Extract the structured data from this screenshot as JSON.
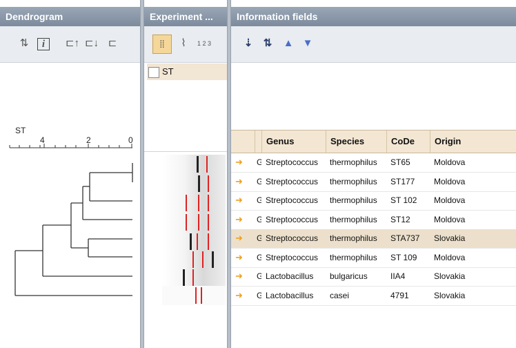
{
  "panels": {
    "dendrogram": {
      "title": "Dendrogram",
      "scale_title": "ST",
      "scale_ticks": [
        "4",
        "2",
        "0"
      ]
    },
    "experiment": {
      "title": "Experiment ...",
      "item_label": "ST"
    },
    "info": {
      "title": "Information fields"
    }
  },
  "toolbar_icons": {
    "dendro": [
      "sort-icon",
      "info-icon",
      "cluster-up-icon",
      "cluster-down-icon",
      "cluster-icon"
    ],
    "experiment": [
      "bands-icon",
      "curve-icon",
      "numbers-icon"
    ],
    "info": [
      "sort-down-icon",
      "sort-both-icon",
      "move-up-icon",
      "move-down-icon"
    ]
  },
  "table": {
    "columns": [
      "Genus",
      "Species",
      "CoDe",
      "Origin"
    ],
    "rows": [
      {
        "prefix": "G",
        "genus": "Streptococcus",
        "species": "thermophilus",
        "code": "ST65",
        "origin": "Moldova",
        "selected": false
      },
      {
        "prefix": "G",
        "genus": "Streptococcus",
        "species": "thermophilus",
        "code": "ST177",
        "origin": "Moldova",
        "selected": false
      },
      {
        "prefix": "G",
        "genus": "Streptococcus",
        "species": "thermophilus",
        "code": "ST 102",
        "origin": "Moldova",
        "selected": false
      },
      {
        "prefix": "G",
        "genus": "Streptococcus",
        "species": "thermophilus",
        "code": "ST12",
        "origin": "Moldova",
        "selected": false
      },
      {
        "prefix": "G",
        "genus": "Streptococcus",
        "species": "thermophilus",
        "code": "STA737",
        "origin": "Slovakia",
        "selected": true
      },
      {
        "prefix": "G",
        "genus": "Streptococcus",
        "species": "thermophilus",
        "code": "ST 109",
        "origin": "Moldova",
        "selected": false
      },
      {
        "prefix": "G",
        "genus": "Lactobacillus",
        "species": "bulgaricus",
        "code": "IIA4",
        "origin": "Slovakia",
        "selected": false
      },
      {
        "prefix": "G",
        "genus": "Lactobacillus",
        "species": "casei",
        "code": "4791",
        "origin": "Slovakia",
        "selected": false
      }
    ]
  },
  "colors": {
    "header": "#8a98aa",
    "selected_row": "#ece0cc",
    "band": "#d22222",
    "arrow": "#f0a020"
  }
}
